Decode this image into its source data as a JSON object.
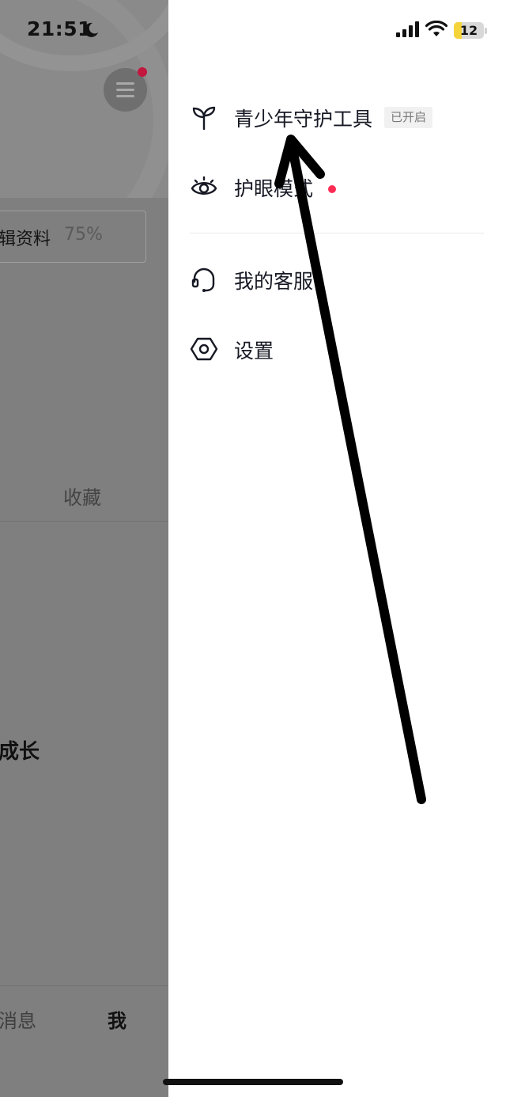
{
  "status_bar": {
    "time": "21:51",
    "battery": "12",
    "battery_level": 0.12,
    "icons": [
      "moon-icon",
      "cellular-signal-icon",
      "wifi-icon",
      "battery-icon"
    ]
  },
  "background_page": {
    "edit_profile_label": "辑资料",
    "edit_profile_percent": "75%",
    "tab_favorites": "收藏",
    "growth_text": "成长",
    "nav_messages": "消息",
    "nav_me": "我"
  },
  "drawer": {
    "items": [
      {
        "label": "青少年守护工具",
        "badge": "已开启",
        "icon": "sprout-icon"
      },
      {
        "label": "护眼模式",
        "icon": "eye-icon",
        "has_dot": true
      },
      {
        "label": "我的客服",
        "icon": "headset-icon"
      },
      {
        "label": "设置",
        "icon": "settings-hexagon-icon"
      }
    ]
  },
  "colors": {
    "overlay_gray": "#7f7f7f",
    "notification_red": "#fe2c55",
    "text_dark": "#161823",
    "annotation_black": "#000000"
  }
}
